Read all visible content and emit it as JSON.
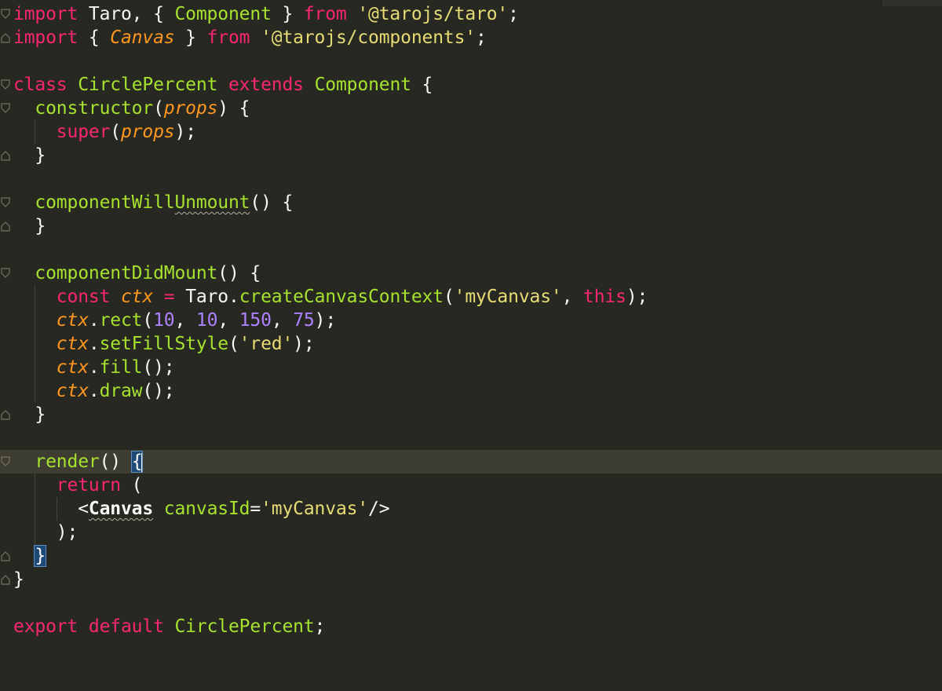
{
  "editor": {
    "theme": "monokai",
    "colors": {
      "background": "#272822",
      "keyword": "#f92672",
      "class": "#a6e22e",
      "string": "#e6db74",
      "number": "#ae81ff",
      "parameter": "#fd971f",
      "text": "#f8f8f2",
      "active_line": "#3e3d32",
      "bracket_match": "#1f4a78"
    },
    "active_line": 20
  },
  "code": {
    "l1": {
      "t1": "import",
      "t2": " Taro, { ",
      "t3": "Component",
      "t4": " } ",
      "t5": "from",
      "t6": " ",
      "t7": "'@tarojs/taro'",
      "t8": ";"
    },
    "l2": {
      "t1": "import",
      "t2": " { ",
      "t3": "Canvas",
      "t4": " } ",
      "t5": "from",
      "t6": " ",
      "t7": "'@tarojs/components'",
      "t8": ";"
    },
    "l4": {
      "t1": "class",
      "t2": " ",
      "t3": "CirclePercent",
      "t4": " ",
      "t5": "extends",
      "t6": " ",
      "t7": "Component",
      "t8": " {"
    },
    "l5": {
      "t1": "constructor",
      "t2": "(",
      "t3": "props",
      "t4": ") {"
    },
    "l6": {
      "t1": "super",
      "t2": "(",
      "t3": "props",
      "t4": ");"
    },
    "l7": {
      "t1": "}"
    },
    "l9": {
      "t1": "componentWill",
      "t2": "Unmount",
      "t3": "() {"
    },
    "l10": {
      "t1": "}"
    },
    "l12": {
      "t1": "componentDidMount",
      "t2": "() {"
    },
    "l13": {
      "t1": "const",
      "t2": " ",
      "t3": "ctx",
      "t4": " ",
      "t5": "=",
      "t6": " Taro.",
      "t7": "createCanvasContext",
      "t8": "(",
      "t9": "'myCanvas'",
      "t10": ", ",
      "t11": "this",
      "t12": ");"
    },
    "l14": {
      "t1": "ctx",
      "t2": ".",
      "t3": "rect",
      "t4": "(",
      "t5": "10",
      "t6": ", ",
      "t7": "10",
      "t8": ", ",
      "t9": "150",
      "t10": ", ",
      "t11": "75",
      "t12": ");"
    },
    "l15": {
      "t1": "ctx",
      "t2": ".",
      "t3": "setFillStyle",
      "t4": "(",
      "t5": "'red'",
      "t6": ");"
    },
    "l16": {
      "t1": "ctx",
      "t2": ".",
      "t3": "fill",
      "t4": "();"
    },
    "l17": {
      "t1": "ctx",
      "t2": ".",
      "t3": "draw",
      "t4": "();"
    },
    "l18": {
      "t1": "}"
    },
    "l20": {
      "t1": "render",
      "t2": "() ",
      "t3": "{"
    },
    "l21": {
      "t1": "return",
      "t2": " ("
    },
    "l22": {
      "t1": "<",
      "t2": "Canvas",
      "t3": " ",
      "t4": "canvasId",
      "t5": "=",
      "t6": "'myCanvas'",
      "t7": "/>"
    },
    "l23": {
      "t1": ");"
    },
    "l24": {
      "t1": "}"
    },
    "l25": {
      "t1": "}"
    },
    "l27": {
      "t1": "export",
      "t2": " ",
      "t3": "default",
      "t4": " ",
      "t5": "CirclePercent",
      "t6": ";"
    }
  }
}
